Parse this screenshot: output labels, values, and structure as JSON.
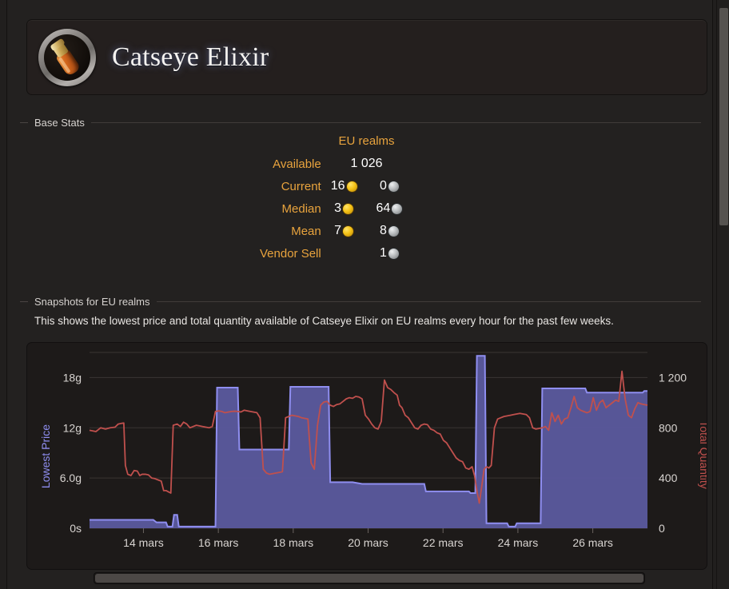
{
  "header": {
    "item_name": "Catseye Elixir",
    "icon": "potion-icon"
  },
  "base_stats": {
    "legend": "Base Stats",
    "column_header": "EU realms",
    "rows": [
      {
        "label": "Available",
        "gold": "",
        "silver": "",
        "plain": "1 026"
      },
      {
        "label": "Current",
        "gold": "16",
        "silver": "0",
        "plain": ""
      },
      {
        "label": "Median",
        "gold": "3",
        "silver": "64",
        "plain": ""
      },
      {
        "label": "Mean",
        "gold": "7",
        "silver": "8",
        "plain": ""
      },
      {
        "label": "Vendor Sell",
        "gold": "",
        "silver": "1",
        "plain": ""
      }
    ]
  },
  "snapshots": {
    "legend": "Snapshots for EU realms",
    "description": "This shows the lowest price and total quantity available of Catseye Elixir on EU realms every hour for the past few weeks."
  },
  "chart_data": {
    "type": "area",
    "title": "",
    "xlabel": "",
    "ylabel": "Lowest Price",
    "y2label": "Total Quantity",
    "grid": true,
    "legend_position": "none",
    "colors": {
      "price_line": "#c0504d",
      "quantity_fill": "#5b5a9e",
      "quantity_line": "#8f8ef0",
      "grid": "#3a3533",
      "axis_text": "#d8d4d1"
    },
    "x_ticks": [
      "14 mars",
      "16 mars",
      "18 mars",
      "20 mars",
      "22 mars",
      "24 mars",
      "26 mars"
    ],
    "y_left_ticks": [
      "0s",
      "6.0g",
      "12g",
      "18g"
    ],
    "y_left_values": [
      0,
      6,
      12,
      18
    ],
    "y_left_range": [
      0,
      21
    ],
    "y_right_ticks": [
      "0",
      "400",
      "800",
      "1 200"
    ],
    "y_right_values": [
      0,
      400,
      800,
      1200
    ],
    "y_right_range": [
      0,
      1400
    ],
    "series": [
      {
        "name": "Lowest Price",
        "axis": "right",
        "color": "#c0504d",
        "points": [
          [
            0.0,
            780
          ],
          [
            0.8,
            770
          ],
          [
            1.4,
            800
          ],
          [
            2.0,
            790
          ],
          [
            2.6,
            800
          ],
          [
            3.2,
            805
          ],
          [
            3.6,
            830
          ],
          [
            4.0,
            835
          ],
          [
            4.3,
            838
          ],
          [
            4.5,
            500
          ],
          [
            4.8,
            430
          ],
          [
            5.2,
            420
          ],
          [
            5.6,
            460
          ],
          [
            6.0,
            455
          ],
          [
            6.3,
            420
          ],
          [
            6.6,
            430
          ],
          [
            7.0,
            430
          ],
          [
            7.4,
            425
          ],
          [
            7.8,
            400
          ],
          [
            8.2,
            395
          ],
          [
            8.6,
            385
          ],
          [
            9.0,
            375
          ],
          [
            9.3,
            300
          ],
          [
            9.6,
            300
          ],
          [
            9.9,
            290
          ],
          [
            10.2,
            280
          ],
          [
            10.5,
            820
          ],
          [
            11.0,
            830
          ],
          [
            11.4,
            810
          ],
          [
            11.8,
            845
          ],
          [
            12.2,
            830
          ],
          [
            12.6,
            800
          ],
          [
            13.0,
            810
          ],
          [
            13.4,
            820
          ],
          [
            13.8,
            815
          ],
          [
            14.2,
            810
          ],
          [
            14.6,
            805
          ],
          [
            15.0,
            800
          ],
          [
            15.4,
            810
          ],
          [
            15.8,
            930
          ],
          [
            16.2,
            935
          ],
          [
            16.6,
            930
          ],
          [
            17.0,
            920
          ],
          [
            17.4,
            925
          ],
          [
            17.8,
            930
          ],
          [
            18.2,
            932
          ],
          [
            18.6,
            930
          ],
          [
            19.0,
            926
          ],
          [
            19.4,
            940
          ],
          [
            19.8,
            935
          ],
          [
            20.2,
            930
          ],
          [
            20.6,
            925
          ],
          [
            21.0,
            920
          ],
          [
            21.4,
            880
          ],
          [
            21.8,
            470
          ],
          [
            22.2,
            440
          ],
          [
            22.6,
            430
          ],
          [
            23.0,
            435
          ],
          [
            23.4,
            440
          ],
          [
            23.8,
            445
          ],
          [
            24.2,
            450
          ],
          [
            24.6,
            880
          ],
          [
            25.0,
            890
          ],
          [
            25.4,
            900
          ],
          [
            25.8,
            895
          ],
          [
            26.2,
            890
          ],
          [
            26.6,
            880
          ],
          [
            27.0,
            875
          ],
          [
            27.4,
            870
          ],
          [
            27.8,
            520
          ],
          [
            28.2,
            470
          ],
          [
            28.6,
            820
          ],
          [
            29.0,
            980
          ],
          [
            29.4,
            1005
          ],
          [
            29.8,
            1010
          ],
          [
            30.2,
            980
          ],
          [
            30.6,
            970
          ],
          [
            31.0,
            985
          ],
          [
            31.4,
            990
          ],
          [
            31.8,
            1010
          ],
          [
            32.2,
            1030
          ],
          [
            32.6,
            1040
          ],
          [
            33.0,
            1035
          ],
          [
            33.4,
            1050
          ],
          [
            33.8,
            1045
          ],
          [
            34.2,
            1030
          ],
          [
            34.6,
            900
          ],
          [
            35.0,
            870
          ],
          [
            35.4,
            830
          ],
          [
            35.8,
            800
          ],
          [
            36.2,
            790
          ],
          [
            36.6,
            850
          ],
          [
            37.0,
            1180
          ],
          [
            37.4,
            1120
          ],
          [
            37.8,
            1105
          ],
          [
            38.2,
            1080
          ],
          [
            38.6,
            1060
          ],
          [
            38.9,
            980
          ],
          [
            39.2,
            960
          ],
          [
            39.6,
            900
          ],
          [
            40.0,
            880
          ],
          [
            40.4,
            840
          ],
          [
            40.8,
            800
          ],
          [
            41.2,
            790
          ],
          [
            41.6,
            820
          ],
          [
            42.0,
            830
          ],
          [
            42.4,
            825
          ],
          [
            42.8,
            790
          ],
          [
            43.2,
            780
          ],
          [
            43.6,
            760
          ],
          [
            44.0,
            750
          ],
          [
            44.4,
            700
          ],
          [
            44.8,
            680
          ],
          [
            45.2,
            640
          ],
          [
            45.6,
            600
          ],
          [
            46.0,
            560
          ],
          [
            46.4,
            540
          ],
          [
            46.8,
            530
          ],
          [
            47.2,
            480
          ],
          [
            47.6,
            470
          ],
          [
            48.0,
            490
          ],
          [
            48.3,
            420
          ],
          [
            48.6,
            300
          ],
          [
            48.9,
            200
          ],
          [
            49.2,
            330
          ],
          [
            49.5,
            470
          ],
          [
            49.8,
            490
          ],
          [
            50.1,
            480
          ],
          [
            50.4,
            500
          ],
          [
            50.8,
            800
          ],
          [
            51.2,
            870
          ],
          [
            51.6,
            880
          ],
          [
            52.0,
            890
          ],
          [
            52.4,
            895
          ],
          [
            52.8,
            900
          ],
          [
            53.2,
            905
          ],
          [
            53.6,
            910
          ],
          [
            54.0,
            915
          ],
          [
            54.4,
            910
          ],
          [
            54.8,
            905
          ],
          [
            55.2,
            880
          ],
          [
            55.6,
            800
          ],
          [
            56.0,
            790
          ],
          [
            56.4,
            795
          ],
          [
            56.8,
            800
          ],
          [
            57.2,
            810
          ],
          [
            57.6,
            780
          ],
          [
            58.0,
            920
          ],
          [
            58.4,
            850
          ],
          [
            58.8,
            900
          ],
          [
            59.2,
            830
          ],
          [
            59.6,
            870
          ],
          [
            60.0,
            880
          ],
          [
            60.4,
            960
          ],
          [
            60.8,
            1050
          ],
          [
            61.2,
            960
          ],
          [
            61.6,
            940
          ],
          [
            62.0,
            930
          ],
          [
            62.4,
            920
          ],
          [
            62.8,
            930
          ],
          [
            63.2,
            1040
          ],
          [
            63.6,
            940
          ],
          [
            64.0,
            1000
          ],
          [
            64.4,
            1020
          ],
          [
            64.8,
            960
          ],
          [
            65.2,
            980
          ],
          [
            65.6,
            1000
          ],
          [
            66.0,
            1020
          ],
          [
            66.4,
            1010
          ],
          [
            66.8,
            1250
          ],
          [
            67.2,
            1030
          ],
          [
            67.6,
            900
          ],
          [
            68.0,
            880
          ],
          [
            68.4,
            950
          ],
          [
            68.8,
            1000
          ],
          [
            69.2,
            990
          ],
          [
            69.6,
            985
          ],
          [
            70.0,
            980
          ]
        ]
      },
      {
        "name": "Total Quantity",
        "axis": "left",
        "color": "#8f8ef0",
        "points": [
          [
            0.0,
            1.0
          ],
          [
            8.0,
            1.0
          ],
          [
            8.4,
            0.7
          ],
          [
            9.6,
            0.7
          ],
          [
            9.8,
            0.2
          ],
          [
            10.4,
            0.2
          ],
          [
            10.6,
            1.6
          ],
          [
            11.0,
            1.6
          ],
          [
            11.2,
            0.2
          ],
          [
            15.6,
            0.2
          ],
          [
            15.8,
            0.2
          ],
          [
            16.0,
            16.8
          ],
          [
            18.6,
            16.8
          ],
          [
            18.8,
            9.4
          ],
          [
            25.0,
            9.4
          ],
          [
            25.2,
            16.9
          ],
          [
            30.0,
            16.9
          ],
          [
            30.2,
            5.5
          ],
          [
            33.0,
            5.5
          ],
          [
            34.2,
            5.3
          ],
          [
            42.0,
            5.3
          ],
          [
            42.2,
            4.4
          ],
          [
            47.6,
            4.4
          ],
          [
            47.8,
            4.2
          ],
          [
            48.4,
            4.2
          ],
          [
            48.6,
            20.6
          ],
          [
            49.6,
            20.6
          ],
          [
            49.8,
            0.6
          ],
          [
            52.4,
            0.6
          ],
          [
            52.6,
            0.2
          ],
          [
            53.4,
            0.2
          ],
          [
            53.6,
            0.6
          ],
          [
            56.6,
            0.6
          ],
          [
            56.8,
            16.7
          ],
          [
            62.2,
            16.7
          ],
          [
            62.4,
            16.2
          ],
          [
            69.4,
            16.2
          ],
          [
            69.6,
            16.4
          ],
          [
            70.0,
            16.4
          ]
        ]
      }
    ]
  },
  "scrollbars": {
    "vertical_position": "top",
    "range_slider_label": "chart-range-scrollbar"
  }
}
